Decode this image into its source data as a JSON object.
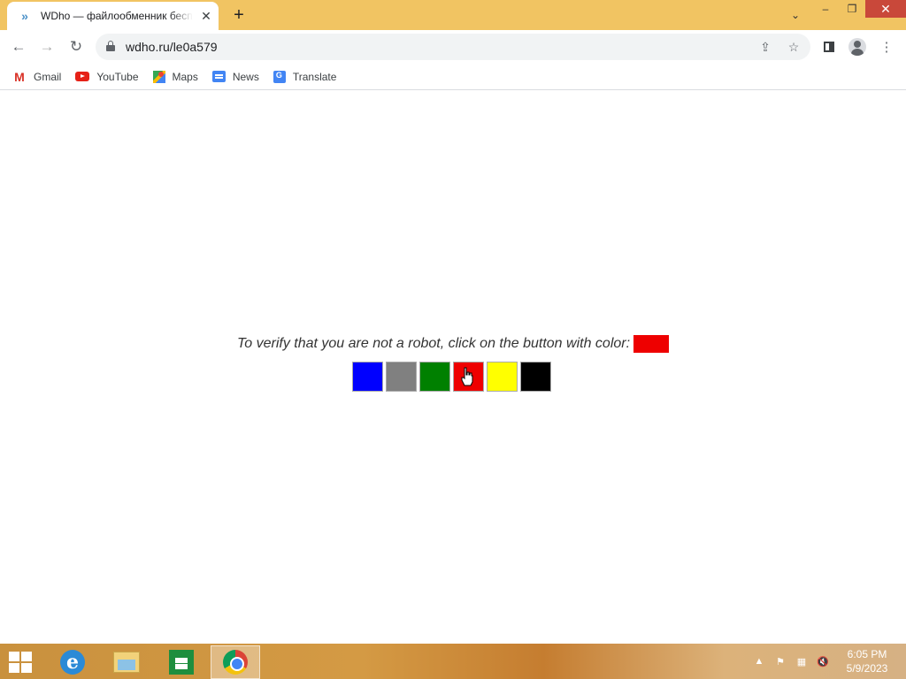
{
  "browser": {
    "tab": {
      "title": "WDho — файлообменник бесплатный",
      "favicon_icon": "double-chevron-icon",
      "close_glyph": "✕"
    },
    "new_tab_glyph": "+",
    "tab_search_glyph": "⌄",
    "window_controls": {
      "minimize_glyph": "–",
      "restore_glyph": "❐",
      "close_glyph": "✕"
    },
    "nav": {
      "back_glyph": "←",
      "forward_glyph": "→",
      "reload_glyph": "↻"
    },
    "address": {
      "url": "wdho.ru/le0a579"
    },
    "omnibox_icons": {
      "share_glyph": "⇪",
      "star_glyph": "☆"
    },
    "menu_glyph": "⋮",
    "bookmarks": [
      {
        "label": "Gmail",
        "icon": "gmail-icon"
      },
      {
        "label": "YouTube",
        "icon": "youtube-icon"
      },
      {
        "label": "Maps",
        "icon": "maps-icon"
      },
      {
        "label": "News",
        "icon": "news-icon"
      },
      {
        "label": "Translate",
        "icon": "translate-icon"
      }
    ]
  },
  "page": {
    "captcha_prompt": "To verify that you are not a robot, click on the button with color:",
    "target_color": "#ee0000",
    "color_buttons": [
      {
        "name": "blue",
        "color": "#0000ff"
      },
      {
        "name": "gray",
        "color": "#808080"
      },
      {
        "name": "green",
        "color": "#008000"
      },
      {
        "name": "red",
        "color": "#ee0000"
      },
      {
        "name": "yellow",
        "color": "#ffff00"
      },
      {
        "name": "black",
        "color": "#000000"
      }
    ]
  },
  "taskbar": {
    "apps": [
      {
        "name": "internet-explorer",
        "icon": "ie-icon"
      },
      {
        "name": "file-explorer",
        "icon": "folder-icon"
      },
      {
        "name": "store",
        "icon": "store-icon"
      },
      {
        "name": "chrome",
        "icon": "chrome-icon",
        "active": true
      }
    ],
    "tray": {
      "chevron_glyph": "▲",
      "time": "6:05 PM",
      "date": "5/9/2023"
    }
  }
}
